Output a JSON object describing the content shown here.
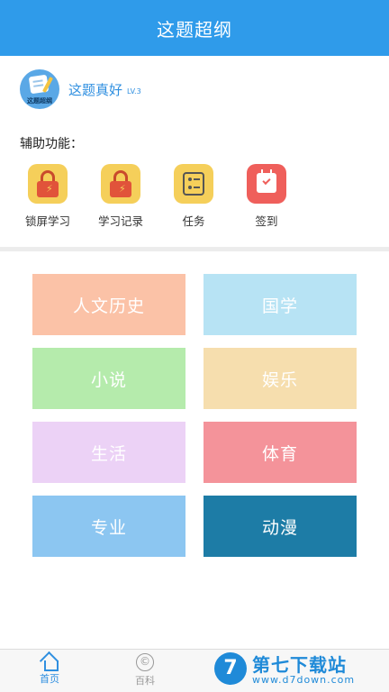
{
  "header": {
    "title": "这题超纲"
  },
  "profile": {
    "avatar_text": "这题超纲",
    "username": "这题真好",
    "level": "LV.3"
  },
  "tools_section": {
    "title": "辅助功能：",
    "items": [
      {
        "label": "锁屏学习",
        "icon": "lock-icon"
      },
      {
        "label": "学习记录",
        "icon": "lock-icon"
      },
      {
        "label": "任务",
        "icon": "task-list-icon"
      },
      {
        "label": "签到",
        "icon": "calendar-check-icon"
      }
    ]
  },
  "categories": [
    {
      "label": "人文历史",
      "color": "#fbc2a7"
    },
    {
      "label": "国学",
      "color": "#b7e3f4"
    },
    {
      "label": "小说",
      "color": "#b5ebac"
    },
    {
      "label": "娱乐",
      "color": "#f6deae"
    },
    {
      "label": "生活",
      "color": "#ecd2f6"
    },
    {
      "label": "体育",
      "color": "#f4939a"
    },
    {
      "label": "专业",
      "color": "#8cc6f1"
    },
    {
      "label": "动漫",
      "color": "#1d7ca6"
    }
  ],
  "bottom_nav": [
    {
      "label": "首页",
      "icon": "home-icon",
      "active": true
    },
    {
      "label": "百科",
      "icon": "copyright-icon",
      "active": false
    }
  ],
  "watermark": {
    "title": "第七下载站",
    "url": "www.d7down.com",
    "logo": "7"
  },
  "colors": {
    "primary": "#2f9bea",
    "divider": "#ececec"
  }
}
